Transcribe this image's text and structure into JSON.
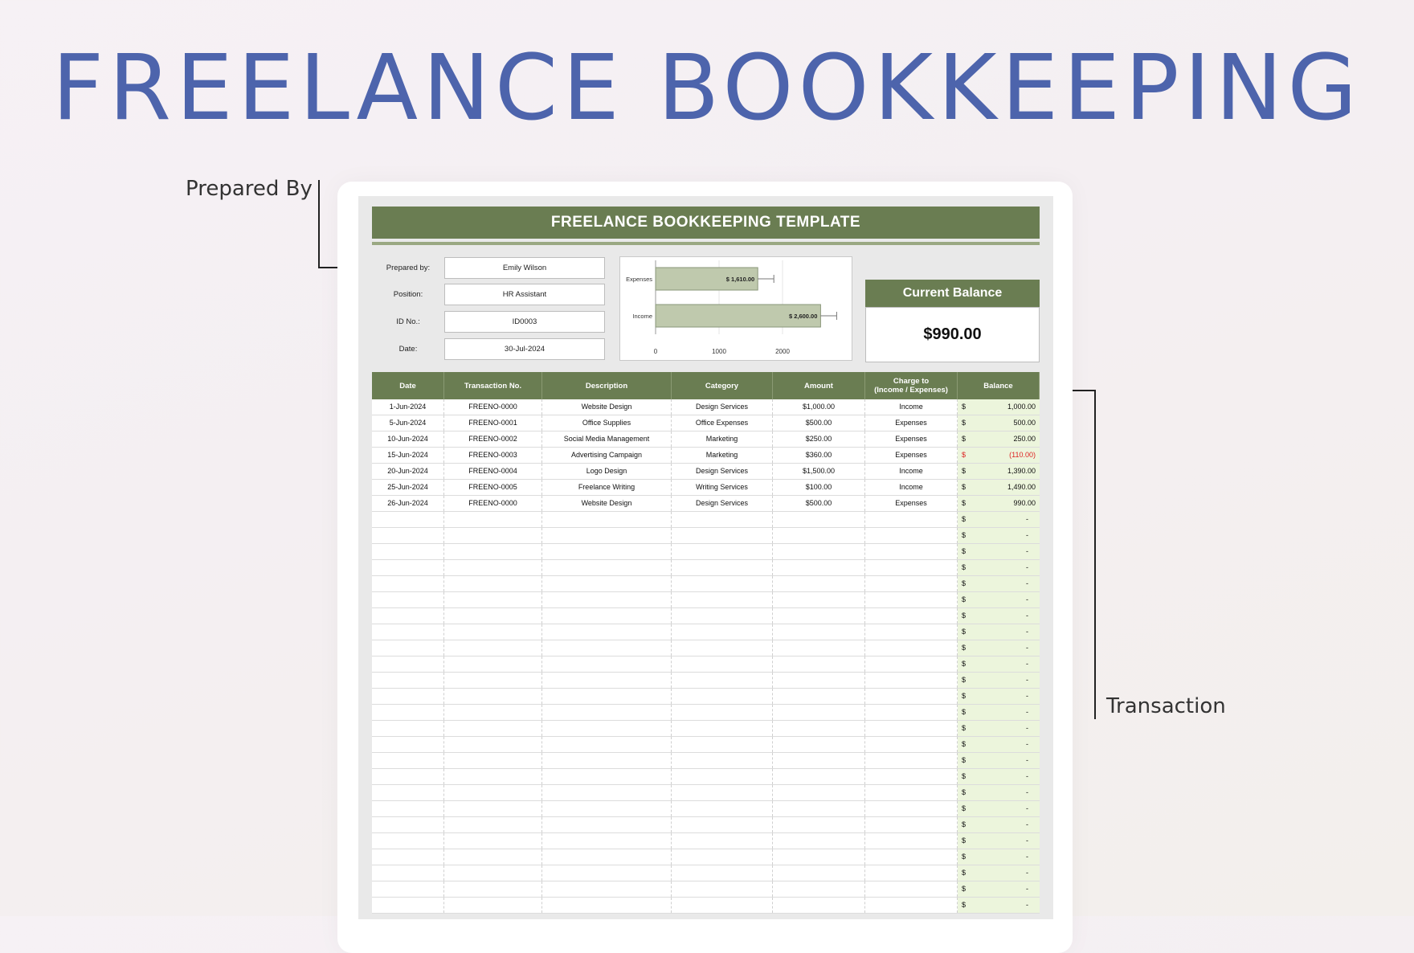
{
  "hero": {
    "title": "FREELANCE BOOKKEEPING"
  },
  "callouts": {
    "prepared_by": "Prepared By",
    "transaction": "Transaction"
  },
  "sheet": {
    "title": "FREELANCE BOOKKEEPING TEMPLATE",
    "info": [
      {
        "label": "Prepared by:",
        "value": "Emily Wilson"
      },
      {
        "label": "Position:",
        "value": "HR Assistant"
      },
      {
        "label": "ID No.:",
        "value": "ID0003"
      },
      {
        "label": "Date:",
        "value": "30-Jul-2024"
      }
    ],
    "balance": {
      "label": "Current Balance",
      "value": "$990.00"
    },
    "columns": [
      "Date",
      "Transaction No.",
      "Description",
      "Category",
      "Amount",
      "Charge to\n(Income / Expenses)",
      "Balance"
    ],
    "currency_symbol": "$",
    "rows": [
      {
        "date": "1-Jun-2024",
        "txn": "FREENO-0000",
        "desc": "Website Design",
        "cat": "Design Services",
        "amount": "$1,000.00",
        "charge": "Income",
        "balance": "1,000.00",
        "negative": false
      },
      {
        "date": "5-Jun-2024",
        "txn": "FREENO-0001",
        "desc": "Office Supplies",
        "cat": "Office Expenses",
        "amount": "$500.00",
        "charge": "Expenses",
        "balance": "500.00",
        "negative": false
      },
      {
        "date": "10-Jun-2024",
        "txn": "FREENO-0002",
        "desc": "Social Media Management",
        "cat": "Marketing",
        "amount": "$250.00",
        "charge": "Expenses",
        "balance": "250.00",
        "negative": false
      },
      {
        "date": "15-Jun-2024",
        "txn": "FREENO-0003",
        "desc": "Advertising Campaign",
        "cat": "Marketing",
        "amount": "$360.00",
        "charge": "Expenses",
        "balance": "(110.00)",
        "negative": true
      },
      {
        "date": "20-Jun-2024",
        "txn": "FREENO-0004",
        "desc": "Logo Design",
        "cat": "Design Services",
        "amount": "$1,500.00",
        "charge": "Income",
        "balance": "1,390.00",
        "negative": false
      },
      {
        "date": "25-Jun-2024",
        "txn": "FREENO-0005",
        "desc": "Freelance Writing",
        "cat": "Writing Services",
        "amount": "$100.00",
        "charge": "Income",
        "balance": "1,490.00",
        "negative": false
      },
      {
        "date": "26-Jun-2024",
        "txn": "FREENO-0000",
        "desc": "Website Design",
        "cat": "Design Services",
        "amount": "$500.00",
        "charge": "Expenses",
        "balance": "990.00",
        "negative": false
      }
    ],
    "empty_balance": "-",
    "empty_row_count": 25
  },
  "colors": {
    "accent": "#6a7d52",
    "title": "#4d64ac",
    "balance_fill": "#ecf5dc",
    "negative": "#dd2222",
    "bar": "#bfc9ad"
  },
  "chart_data": {
    "type": "bar",
    "orientation": "horizontal",
    "categories": [
      "Expenses",
      "Income"
    ],
    "values": [
      1610,
      2600
    ],
    "data_labels": [
      "$ 1,610.00",
      "$ 2,600.00"
    ],
    "xticks": [
      "0",
      "1000",
      "2000"
    ],
    "xlim": [
      0,
      3000
    ],
    "grid": true
  }
}
